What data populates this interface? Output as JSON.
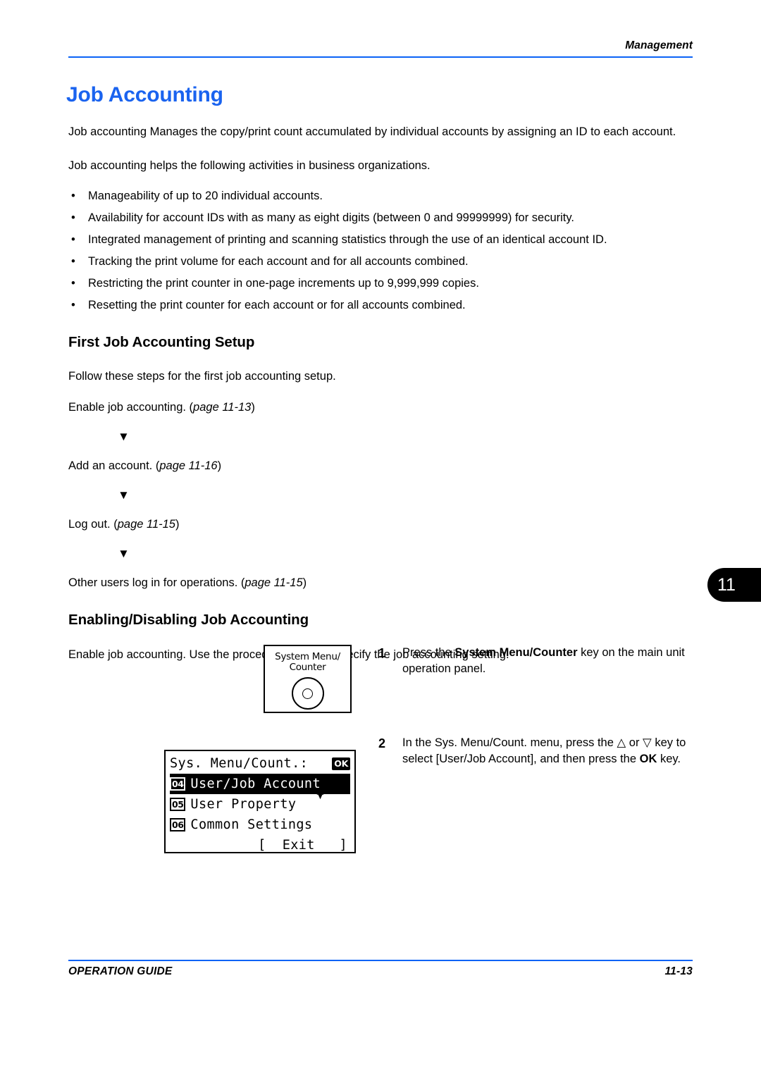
{
  "header": {
    "section_label": "Management"
  },
  "title": "Job Accounting",
  "intro": {
    "paragraph1": "Job accounting Manages the copy/print count accumulated by individual accounts by assigning an ID to each account.",
    "paragraph2": "Job accounting helps the following activities in business organizations."
  },
  "bullets": [
    "Manageability of up to 20 individual accounts.",
    "Availability for account IDs with as many as eight digits (between 0 and 99999999) for security.",
    "Integrated management of printing and scanning statistics through the use of an identical account ID.",
    "Tracking the print volume for each account and for all accounts combined.",
    "Restricting the print counter in one-page increments up to 9,999,999 copies.",
    "Resetting the print counter for each account or for all accounts combined."
  ],
  "bullet_marker": "•",
  "first_setup": {
    "heading": "First Job Accounting Setup",
    "intro": "Follow these steps for the first job accounting setup.",
    "steps": [
      {
        "text": "Enable job accounting. (",
        "ref": "page 11-13",
        "close": ")"
      },
      {
        "text": "Add an account. (",
        "ref": "page 11-16",
        "close": ")"
      },
      {
        "text": "Log out. (",
        "ref": "page 11-15",
        "close": ")"
      },
      {
        "text": "Other users log in for operations. (",
        "ref": "page 11-15",
        "close": ")"
      }
    ],
    "arrow_glyph": "▼"
  },
  "enabling": {
    "heading": "Enabling/Disabling Job Accounting",
    "intro": "Enable job accounting. Use the procedure below to specify the job accounting setting."
  },
  "procedure": {
    "step1": {
      "number": "1",
      "text_a": "Press the ",
      "bold_a": "System Menu/Counter",
      "text_b": " key on the main unit operation panel."
    },
    "step2": {
      "number": "2",
      "text_a": "In the Sys. Menu/Count. menu, press the ",
      "up_glyph": "△",
      "text_or": " or ",
      "down_glyph": "▽",
      "text_b": " key to select [User/Job Account], and then press the ",
      "bold_b": "OK",
      "text_c": " key."
    }
  },
  "system_menu_key": {
    "label_line1": "System Menu/",
    "label_line2": "Counter"
  },
  "lcd": {
    "title": "Sys. Menu/Count.:",
    "ok_badge": "OK",
    "rows": [
      {
        "num": "04",
        "label": "User/Job Account",
        "selected": true
      },
      {
        "num": "05",
        "label": "User Property",
        "selected": false
      },
      {
        "num": "06",
        "label": "Common Settings",
        "selected": false
      }
    ],
    "exit": "[  Exit   ]"
  },
  "chapter_tab": "11",
  "footer": {
    "left": "OPERATION GUIDE",
    "right": "11-13"
  },
  "colors": {
    "accent_blue": "#0b63f6",
    "title_blue": "#1a63ef"
  }
}
